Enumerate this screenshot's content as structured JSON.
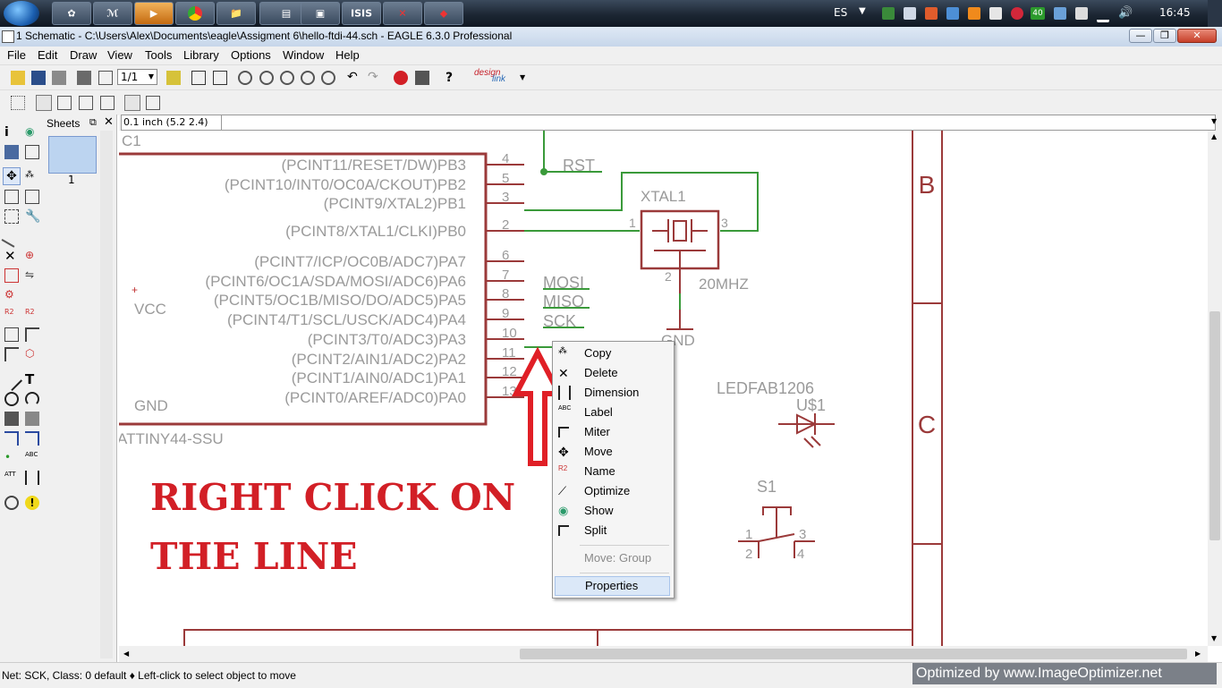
{
  "taskbar": {
    "language": "ES",
    "clock": "16:45",
    "badge_count": "40"
  },
  "window": {
    "title": "1 Schematic - C:\\Users\\Alex\\Documents\\eagle\\Assigment 6\\hello-ftdi-44.sch - EAGLE 6.3.0 Professional"
  },
  "menu": [
    "File",
    "Edit",
    "Draw",
    "View",
    "Tools",
    "Library",
    "Options",
    "Window",
    "Help"
  ],
  "toolbar": {
    "sheet_select": "1/1",
    "designlink_top": "design",
    "designlink_bottom": "link"
  },
  "sheets": {
    "title": "Sheets",
    "page_number": "1"
  },
  "grid_readout": "0.1 inch (5.2 2.4)",
  "schematic": {
    "ic_name": "C1",
    "ic_part": "ATTINY44-SSU",
    "left_pins": [
      "VCC",
      "GND"
    ],
    "pins": [
      {
        "label": "(PCINT11/RESET/DW)PB3",
        "num": "4"
      },
      {
        "label": "(PCINT10/INT0/OC0A/CKOUT)PB2",
        "num": "5"
      },
      {
        "label": "(PCINT9/XTAL2)PB1",
        "num": "3"
      },
      {
        "label": "(PCINT8/XTAL1/CLKI)PB0",
        "num": "2"
      },
      {
        "label": "(PCINT7/ICP/OC0B/ADC7)PA7",
        "num": "6"
      },
      {
        "label": "(PCINT6/OC1A/SDA/MOSI/ADC6)PA6",
        "num": "7"
      },
      {
        "label": "(PCINT5/OC1B/MISO/DO/ADC5)PA5",
        "num": "8"
      },
      {
        "label": "(PCINT4/T1/SCL/USCK/ADC4)PA4",
        "num": "9"
      },
      {
        "label": "(PCINT3/T0/ADC3)PA3",
        "num": "10"
      },
      {
        "label": "(PCINT2/AIN1/ADC2)PA2",
        "num": "11"
      },
      {
        "label": "(PCINT1/AIN0/ADC1)PA1",
        "num": "12"
      },
      {
        "label": "(PCINT0/AREF/ADC0)PA0",
        "num": "13"
      }
    ],
    "net_labels": [
      "RST",
      "MOSI",
      "MISO",
      "SCK"
    ],
    "xtal_name": "XTAL1",
    "xtal_value": "20MHZ",
    "xtal_pin1": "1",
    "xtal_pin2": "2",
    "xtal_pin3": "3",
    "gnd_label": "GND",
    "led_value": "LEDFAB1206",
    "led_name": "U$1",
    "switch_name": "S1",
    "switch_pins": [
      "1",
      "3",
      "2",
      "4"
    ],
    "frame_letters": [
      "B",
      "C"
    ],
    "annotation_line1": "RIGHT CLICK ON",
    "annotation_line2": "THE LINE"
  },
  "context_menu": {
    "items": [
      "Copy",
      "Delete",
      "Dimension",
      "Label",
      "Miter",
      "Move",
      "Name",
      "Optimize",
      "Show",
      "Split"
    ],
    "disabled_item": "Move: Group",
    "last_item": "Properties"
  },
  "status": "Net: SCK, Class: 0 default  ♦ Left-click to select object to move",
  "watermark": "Optimized by www.ImageOptimizer.net",
  "colors": {
    "symbol": "#9b3a3a",
    "net": "#3a9a3a",
    "text_gray": "#9a9a9a",
    "annotation": "#d21f26"
  }
}
